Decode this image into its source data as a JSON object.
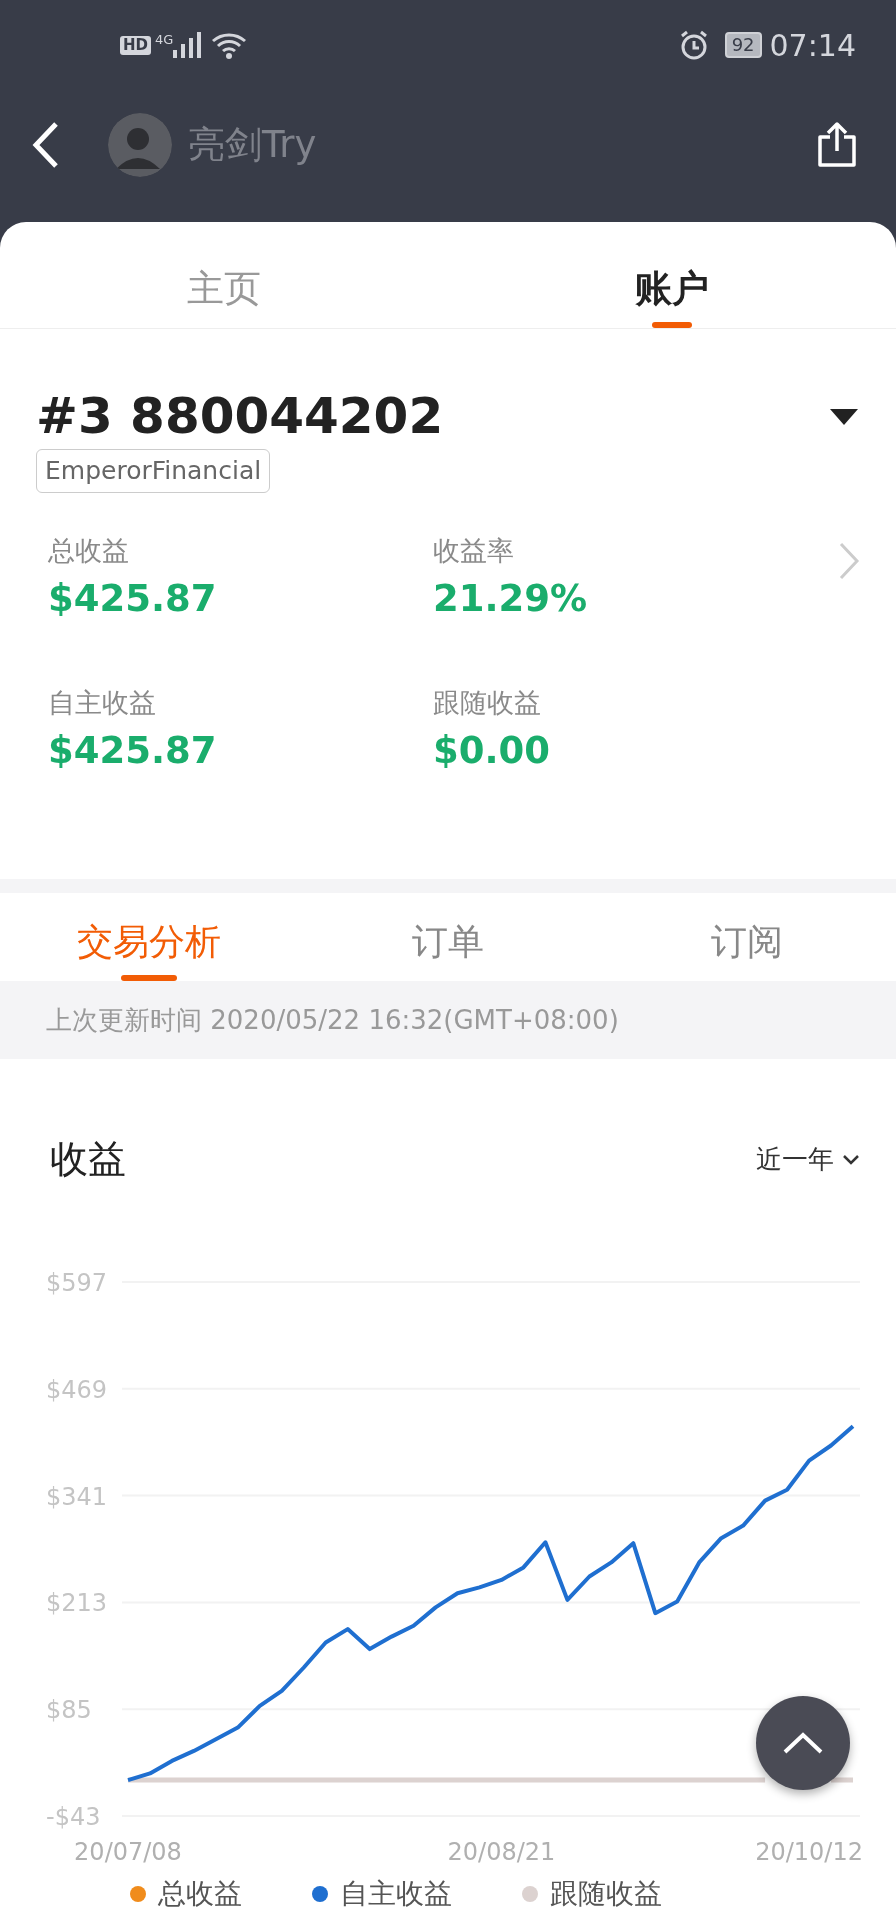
{
  "status_bar": {
    "hd": "HD",
    "network": "4G",
    "battery": "92",
    "time": "07:14"
  },
  "header": {
    "title": "亮剑Try"
  },
  "top_tabs": [
    {
      "label": "主页",
      "selected": false
    },
    {
      "label": "账户",
      "selected": true
    }
  ],
  "account": {
    "title": "#3 880044202",
    "broker": "EmperorFinancial",
    "stats": [
      {
        "label": "总收益",
        "value": "$425.87"
      },
      {
        "label": "收益率",
        "value": "21.29%"
      },
      {
        "label": "自主收益",
        "value": "$425.87"
      },
      {
        "label": "跟随收益",
        "value": "$0.00"
      }
    ]
  },
  "sub_tabs": [
    {
      "label": "交易分析",
      "selected": true
    },
    {
      "label": "订单",
      "selected": false
    },
    {
      "label": "订阅",
      "selected": false
    }
  ],
  "last_update": "上次更新时间 2020/05/22 16:32(GMT+08:00)",
  "chart_section": {
    "title": "收益",
    "period": "近一年",
    "chart_data": {
      "type": "line",
      "categories": [
        "20/07/08",
        null,
        null,
        null,
        null,
        null,
        null,
        null,
        null,
        null,
        null,
        null,
        null,
        null,
        null,
        null,
        null,
        "20/08/21",
        null,
        null,
        null,
        null,
        null,
        null,
        null,
        null,
        null,
        null,
        null,
        null,
        null,
        "20/10/12",
        null,
        null
      ],
      "ylim": [
        -43,
        597
      ],
      "yticks": [
        {
          "value": 597,
          "label": "$597"
        },
        {
          "value": 469,
          "label": "$469"
        },
        {
          "value": 341,
          "label": "$341"
        },
        {
          "value": 213,
          "label": "$213"
        },
        {
          "value": 85,
          "label": "$85"
        },
        {
          "value": -43,
          "label": "-$43"
        }
      ],
      "series": [
        {
          "name": "总收益",
          "color": "#f08c1c",
          "values": [
            null,
            null,
            null,
            null,
            null,
            null,
            null,
            null,
            null,
            null,
            null,
            null,
            null,
            null,
            null,
            null,
            null,
            null,
            null,
            null,
            null,
            null,
            null,
            null,
            null,
            null,
            null,
            null,
            null,
            null,
            null,
            null,
            null,
            null
          ]
        },
        {
          "name": "自主收益",
          "color": "#1f6fd0",
          "values": [
            0,
            8,
            23,
            35,
            49,
            63,
            89,
            107,
            135,
            165,
            181,
            157,
            172,
            185,
            207,
            224,
            231,
            240,
            255,
            285,
            216,
            244,
            261,
            284,
            200,
            214,
            261,
            290,
            305,
            335,
            348,
            383,
            401,
            424
          ]
        },
        {
          "name": "跟随收益",
          "color": "#dcd2d0",
          "values": [
            0,
            0,
            0,
            0,
            0,
            0,
            0,
            0,
            0,
            0,
            0,
            0,
            0,
            0,
            0,
            0,
            0,
            0,
            0,
            0,
            0,
            0,
            0,
            0,
            0,
            0,
            0,
            0,
            0,
            0,
            null,
            null,
            0,
            0
          ]
        }
      ],
      "grid": true
    }
  }
}
